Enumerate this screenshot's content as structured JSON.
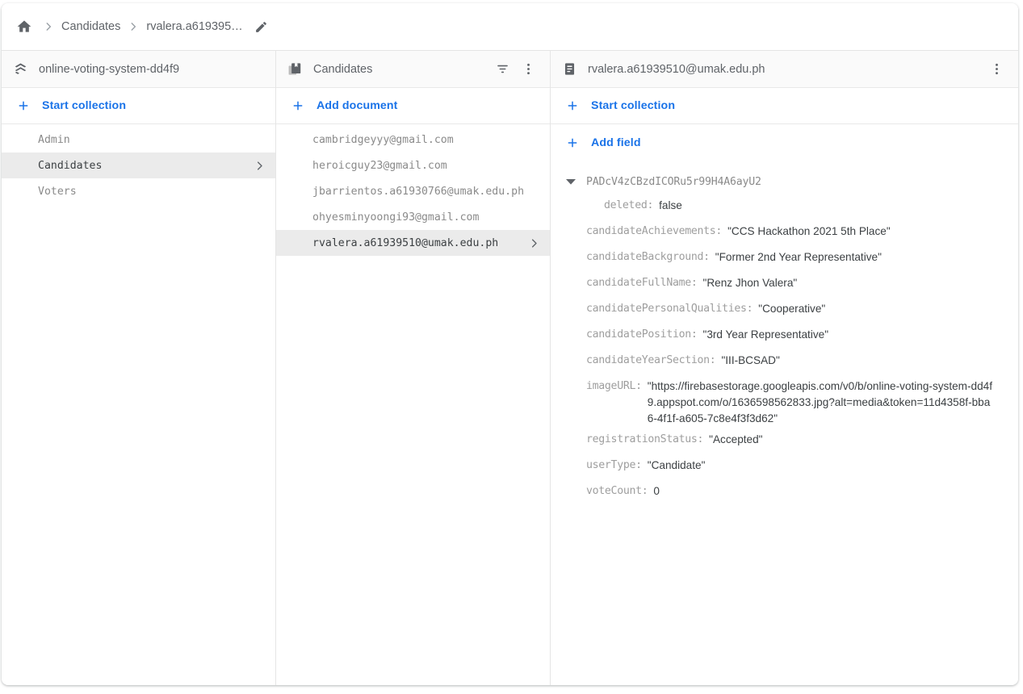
{
  "breadcrumb": {
    "home_icon": "home-icon",
    "separator": "chevron-right-icon",
    "items": [
      {
        "label": "Candidates"
      },
      {
        "label": "rvalera.a619395…"
      }
    ],
    "edit_icon": "pencil-icon"
  },
  "project_pane": {
    "icon": "firestore-project-icon",
    "title": "online-voting-system-dd4f9",
    "action_label": "Start collection",
    "collections": [
      {
        "name": "Admin",
        "selected": false
      },
      {
        "name": "Candidates",
        "selected": true
      },
      {
        "name": "Voters",
        "selected": false
      }
    ]
  },
  "collection_pane": {
    "icon": "collection-icon",
    "title": "Candidates",
    "filter_icon": "filter-icon",
    "overflow_icon": "more-vert-icon",
    "action_label": "Add document",
    "documents": [
      {
        "id": "cambridgeyyy@gmail.com",
        "selected": false
      },
      {
        "id": "heroicguy23@gmail.com",
        "selected": false
      },
      {
        "id": "jbarrientos.a61930766@umak.edu.ph",
        "selected": false
      },
      {
        "id": "ohyesminyoongi93@gmail.com",
        "selected": false
      },
      {
        "id": "rvalera.a61939510@umak.edu.ph",
        "selected": true
      }
    ]
  },
  "document_pane": {
    "icon": "document-icon",
    "title": "rvalera.a61939510@umak.edu.ph",
    "overflow_icon": "more-vert-icon",
    "start_collection_label": "Start collection",
    "add_field_label": "Add field",
    "doc_id": "PADcV4zCBzdICORu5r99H4A6ayU2",
    "caret_icon": "caret-down-icon",
    "subfield": {
      "key": "deleted:",
      "value": "false"
    },
    "fields": [
      {
        "key": "candidateAchievements:",
        "value": "\"CCS Hackathon 2021 5th Place\""
      },
      {
        "key": "candidateBackground:",
        "value": "\"Former 2nd Year Representative\""
      },
      {
        "key": "candidateFullName:",
        "value": "\"Renz Jhon Valera\""
      },
      {
        "key": "candidatePersonalQualities:",
        "value": "\"Cooperative\""
      },
      {
        "key": "candidatePosition:",
        "value": "\"3rd Year Representative\""
      },
      {
        "key": "candidateYearSection:",
        "value": "\"III-BCSAD\""
      }
    ],
    "image_field": {
      "key": "imageURL:",
      "value": "\"https://firebasestorage.googleapis.com/v0/b/online-voting-system-dd4f9.appspot.com/o/1636598562833.jpg?alt=media&token=11d4358f-bba6-4f1f-a605-7c8e4f3f3d62\""
    },
    "fields_tail": [
      {
        "key": "registrationStatus:",
        "value": "\"Accepted\""
      },
      {
        "key": "userType:",
        "value": "\"Candidate\""
      },
      {
        "key": "voteCount:",
        "value": "0"
      }
    ]
  },
  "colors": {
    "accent_blue": "#1a73e8",
    "text_gray": "#5f6368",
    "mono_gray": "#9e9e9e",
    "selected_bg": "#ebebeb",
    "header_bg": "#fafafa"
  }
}
